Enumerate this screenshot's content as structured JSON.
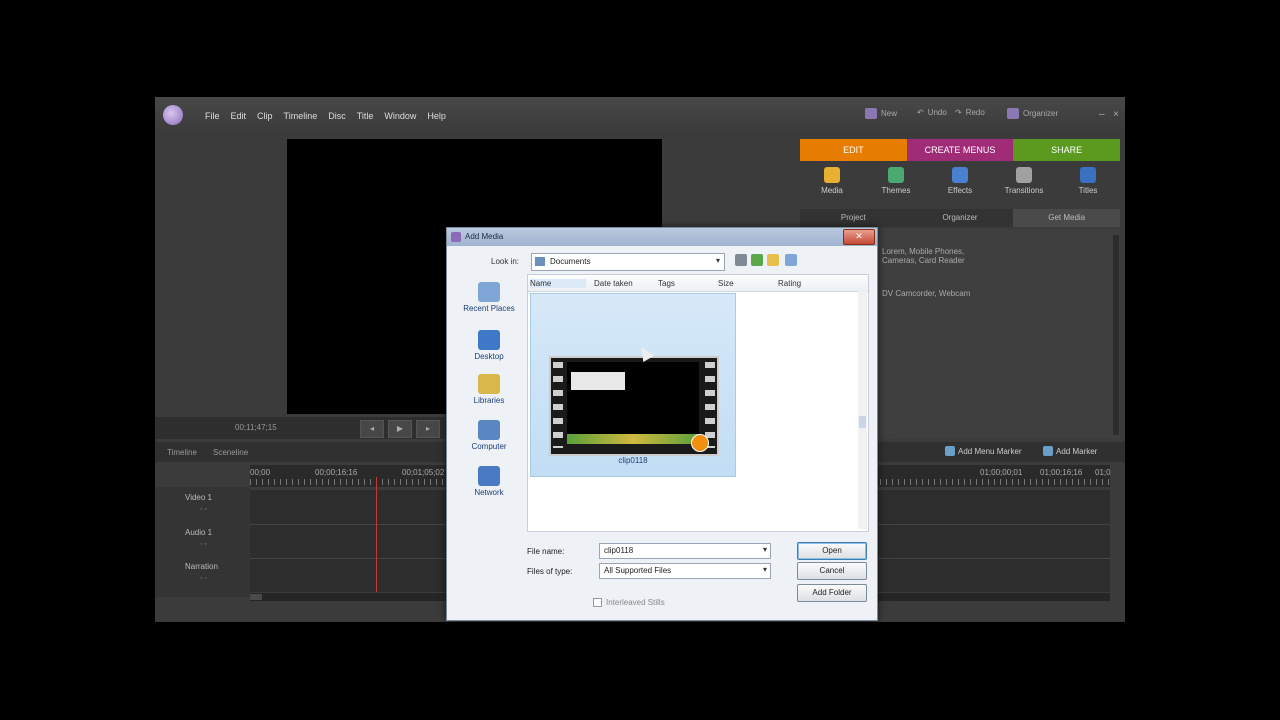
{
  "app": {
    "menu": [
      "File",
      "Edit",
      "Clip",
      "Timeline",
      "Disc",
      "Title",
      "Window",
      "Help"
    ],
    "top_right": {
      "new": "New",
      "undo": "Undo",
      "redo": "Redo",
      "organizer": "Organizer"
    },
    "window_controls": [
      "–",
      "×"
    ]
  },
  "monitor": {
    "timecode": "00;11;47;15",
    "buttons": [
      "◂",
      "▶",
      "▸"
    ]
  },
  "right_panel": {
    "tabs": [
      {
        "label": "EDIT",
        "color": "#e77d00"
      },
      {
        "label": "CREATE MENUS",
        "color": "#a02c78"
      },
      {
        "label": "SHARE",
        "color": "#5b9a1f"
      }
    ],
    "tools": [
      {
        "label": "Media",
        "color": "#e8b030"
      },
      {
        "label": "Themes",
        "color": "#4aa870"
      },
      {
        "label": "Effects",
        "color": "#4a80d0"
      },
      {
        "label": "Transitions",
        "color": "#a0a0a0"
      },
      {
        "label": "Titles",
        "color": "#3a70c0"
      }
    ],
    "subtabs": [
      "Project",
      "Organizer",
      "Get Media"
    ],
    "panel_lines": [
      "Lorem, Mobile Phones,",
      "Cameras, Card Reader",
      "",
      "",
      "",
      "DV Camcorder, Webcam"
    ]
  },
  "timeline": {
    "header_left": [
      "Timeline",
      "Sceneline"
    ],
    "add_buttons": [
      "Add Menu Marker",
      "Add Marker"
    ],
    "ruler_labels": [
      "00;00",
      "00;00;16;16",
      "00;01;05;02",
      "01;00;00;01",
      "01;00;16;16",
      "01;0"
    ],
    "tracks": [
      {
        "label": "Video 1",
        "sub": "◦ ◦"
      },
      {
        "label": "Audio 1",
        "sub": "◦ ◦"
      },
      {
        "label": "Narration",
        "sub": "◦ ◦"
      }
    ]
  },
  "dialog": {
    "title": "Add Media",
    "look_in_label": "Look in:",
    "look_in_value": "Documents",
    "places": [
      {
        "label": "Recent Places",
        "color": "#7fa6d6"
      },
      {
        "label": "Desktop",
        "color": "#3f78c6"
      },
      {
        "label": "Libraries",
        "color": "#d8b84a"
      },
      {
        "label": "Computer",
        "color": "#5a86c2"
      },
      {
        "label": "Network",
        "color": "#4a7ac4"
      }
    ],
    "columns": [
      "Name",
      "Date taken",
      "Tags",
      "Size",
      "Rating"
    ],
    "file": {
      "name": "clip0118"
    },
    "file_name_label": "File name:",
    "file_name_value": "clip0118",
    "files_of_type_label": "Files of type:",
    "files_of_type_value": "All Supported Files",
    "buttons": {
      "open": "Open",
      "cancel": "Cancel",
      "add_folder": "Add Folder"
    },
    "checkbox": "Interleaved Stills"
  }
}
